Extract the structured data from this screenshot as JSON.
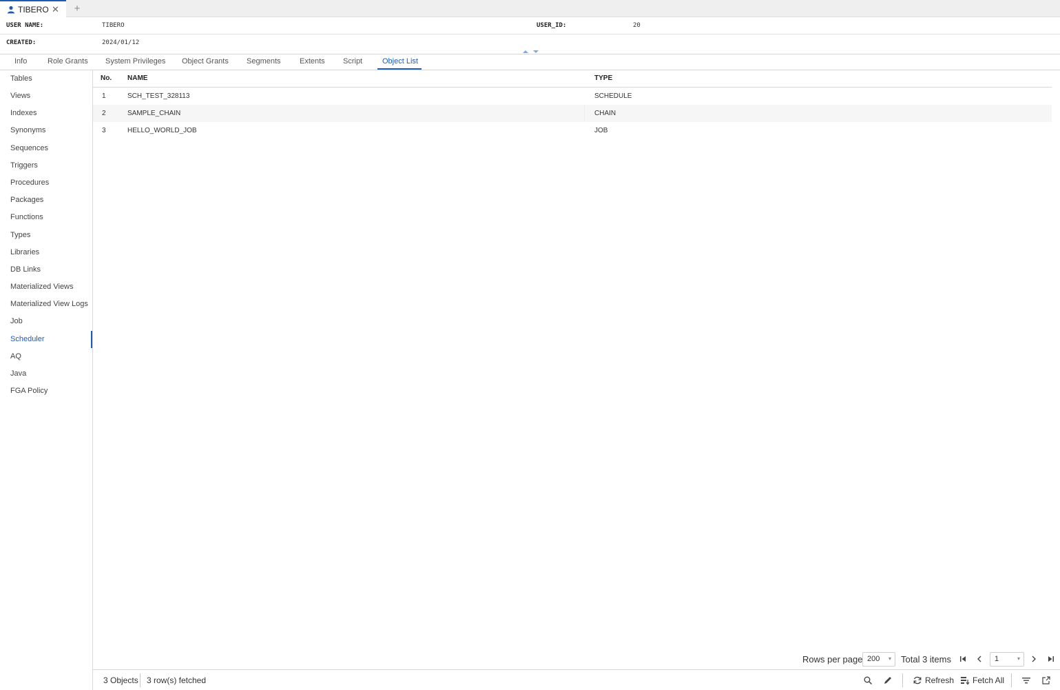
{
  "document_tab": {
    "label": "TIBERO",
    "icon": "user-icon",
    "close_icon": "close-icon",
    "new_tab_icon": "plus-icon"
  },
  "info": {
    "user_name_label": "USER NAME:",
    "user_name": "TIBERO",
    "user_id_label": "USER_ID:",
    "user_id": "20",
    "created_label": "CREATED:",
    "created": "2024/01/12"
  },
  "tabs": [
    {
      "label": "Info"
    },
    {
      "label": "Role Grants"
    },
    {
      "label": "System Privileges"
    },
    {
      "label": "Object Grants"
    },
    {
      "label": "Segments"
    },
    {
      "label": "Extents"
    },
    {
      "label": "Script"
    },
    {
      "label": "Object List",
      "active": true
    }
  ],
  "sidebar": {
    "items": [
      {
        "label": "Tables"
      },
      {
        "label": "Views"
      },
      {
        "label": "Indexes"
      },
      {
        "label": "Synonyms"
      },
      {
        "label": "Sequences"
      },
      {
        "label": "Triggers"
      },
      {
        "label": "Procedures"
      },
      {
        "label": "Packages"
      },
      {
        "label": "Functions"
      },
      {
        "label": "Types"
      },
      {
        "label": "Libraries"
      },
      {
        "label": "DB Links"
      },
      {
        "label": "Materialized Views"
      },
      {
        "label": "Materialized View Logs"
      },
      {
        "label": "Job"
      },
      {
        "label": "Scheduler",
        "active": true
      },
      {
        "label": "AQ"
      },
      {
        "label": "Java"
      },
      {
        "label": "FGA Policy"
      }
    ]
  },
  "grid": {
    "columns": [
      "No.",
      "NAME",
      "TYPE"
    ],
    "rows": [
      {
        "no": "1",
        "name": "SCH_TEST_328113",
        "type": "SCHEDULE"
      },
      {
        "no": "2",
        "name": "SAMPLE_CHAIN",
        "type": "CHAIN"
      },
      {
        "no": "3",
        "name": "HELLO_WORLD_JOB",
        "type": "JOB"
      }
    ]
  },
  "pagination": {
    "rows_per_page_label": "Rows per page",
    "rows_per_page": "200",
    "total_label": "Total 3 items",
    "page": "1"
  },
  "status": {
    "objects": "3 Objects",
    "fetched": "3 row(s) fetched",
    "refresh_label": "Refresh",
    "fetch_all_label": "Fetch All"
  },
  "colors": {
    "accent": "#1d5bb8",
    "border": "#d8d8d8",
    "alt_row": "#f6f6f6"
  }
}
